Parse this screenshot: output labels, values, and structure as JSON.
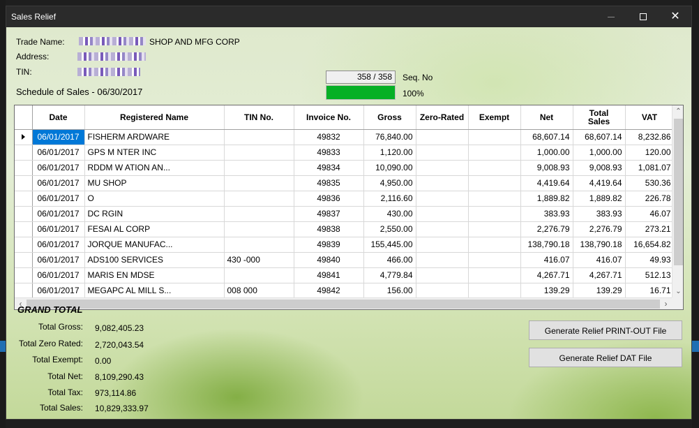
{
  "window": {
    "title": "Sales Relief",
    "close_glyph": "✕"
  },
  "info": {
    "trade_name_label": "Trade Name:",
    "trade_name_value": "SHOP AND MFG CORP",
    "address_label": "Address:",
    "tin_label": "TIN:",
    "schedule_title": "Schedule of Sales - 06/30/2017"
  },
  "progress": {
    "counter": "358 / 358",
    "counter_label": "Seq. No",
    "percent_text": "100%",
    "fraction": 1.0,
    "fill_color": "#06b025"
  },
  "grid": {
    "columns": [
      "Date",
      "Registered Name",
      "TIN No.",
      "Invoice No.",
      "Gross",
      "Zero-Rated",
      "Exempt",
      "Net",
      "Total Sales",
      "VAT"
    ],
    "rows": [
      {
        "date": "06/01/2017",
        "name": "FISHERM  ARDWARE",
        "tin": "",
        "invoice": "49832",
        "gross": "76,840.00",
        "zero": "",
        "exempt": "",
        "net": "68,607.14",
        "total": "68,607.14",
        "vat": "8,232.86"
      },
      {
        "date": "06/01/2017",
        "name": "GPS M  NTER INC",
        "tin": "",
        "invoice": "49833",
        "gross": "1,120.00",
        "zero": "",
        "exempt": "",
        "net": "1,000.00",
        "total": "1,000.00",
        "vat": "120.00"
      },
      {
        "date": "06/01/2017",
        "name": "RDDM W  ATION AN...",
        "tin": "",
        "invoice": "49834",
        "gross": "10,090.00",
        "zero": "",
        "exempt": "",
        "net": "9,008.93",
        "total": "9,008.93",
        "vat": "1,081.07"
      },
      {
        "date": "06/01/2017",
        "name": "MU  SHOP",
        "tin": "",
        "invoice": "49835",
        "gross": "4,950.00",
        "zero": "",
        "exempt": "",
        "net": "4,419.64",
        "total": "4,419.64",
        "vat": "530.36"
      },
      {
        "date": "06/01/2017",
        "name": "  O",
        "tin": "",
        "invoice": "49836",
        "gross": "2,116.60",
        "zero": "",
        "exempt": "",
        "net": "1,889.82",
        "total": "1,889.82",
        "vat": "226.78"
      },
      {
        "date": "06/01/2017",
        "name": "DC  RGIN",
        "tin": "",
        "invoice": "49837",
        "gross": "430.00",
        "zero": "",
        "exempt": "",
        "net": "383.93",
        "total": "383.93",
        "vat": "46.07"
      },
      {
        "date": "06/01/2017",
        "name": "FESAI  AL CORP",
        "tin": "",
        "invoice": "49838",
        "gross": "2,550.00",
        "zero": "",
        "exempt": "",
        "net": "2,276.79",
        "total": "2,276.79",
        "vat": "273.21"
      },
      {
        "date": "06/01/2017",
        "name": "JORQUE  MANUFAC...",
        "tin": "",
        "invoice": "49839",
        "gross": "155,445.00",
        "zero": "",
        "exempt": "",
        "net": "138,790.18",
        "total": "138,790.18",
        "vat": "16,654.82"
      },
      {
        "date": "06/01/2017",
        "name": "ADS100  SERVICES",
        "tin": "430  -000",
        "invoice": "49840",
        "gross": "466.00",
        "zero": "",
        "exempt": "",
        "net": "416.07",
        "total": "416.07",
        "vat": "49.93"
      },
      {
        "date": "06/01/2017",
        "name": "MARIS  EN MDSE",
        "tin": "",
        "invoice": "49841",
        "gross": "4,779.84",
        "zero": "",
        "exempt": "",
        "net": "4,267.71",
        "total": "4,267.71",
        "vat": "512.13"
      },
      {
        "date": "06/01/2017",
        "name": "MEGAPC  AL MILL S...",
        "tin": "008  000",
        "invoice": "49842",
        "gross": "156.00",
        "zero": "",
        "exempt": "",
        "net": "139.29",
        "total": "139.29",
        "vat": "16.71"
      }
    ],
    "scroll_up": "⌃",
    "scroll_down": "⌄",
    "scroll_left": "‹",
    "scroll_right": "›"
  },
  "totals": {
    "heading": "GRAND TOTAL",
    "gross_label": "Total Gross:",
    "gross_value": "9,082,405.23",
    "zero_label": "Total Zero Rated:",
    "zero_value": "2,720,043.54",
    "exempt_label": "Total Exempt:",
    "exempt_value": "0.00",
    "net_label": "Total Net:",
    "net_value": "8,109,290.43",
    "tax_label": "Total Tax:",
    "tax_value": "973,114.86",
    "sales_label": "Total Sales:",
    "sales_value": "10,829,333.97"
  },
  "buttons": {
    "printout": "Generate Relief PRINT-OUT File",
    "dat": "Generate Relief DAT File"
  }
}
